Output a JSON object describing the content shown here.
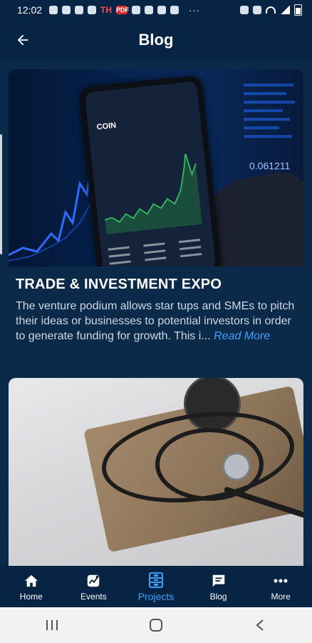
{
  "status_bar": {
    "time": "12:02",
    "th_label": "TH",
    "pdf_label": "PDF",
    "overflow": "···"
  },
  "header": {
    "title": "Blog"
  },
  "posts": [
    {
      "title": "TRADE & INVESTMENT EXPO",
      "excerpt": "The venture podium allows star tups and SMEs to pitch their ideas or businesses to potential investors in order to generate funding for growth. This i...",
      "read_more": "Read More",
      "image_alt": "phone showing stock chart",
      "image_text": "COIN"
    },
    {
      "title": "",
      "excerpt": "",
      "read_more": "",
      "image_alt": "stethoscope and blood pressure cuff"
    }
  ],
  "bottom_nav": {
    "items": [
      {
        "label": "Home",
        "icon": "home-icon"
      },
      {
        "label": "Events",
        "icon": "events-icon"
      },
      {
        "label": "Projects",
        "icon": "projects-icon",
        "active": true
      },
      {
        "label": "Blog",
        "icon": "blog-icon"
      },
      {
        "label": "More",
        "icon": "more-icon"
      }
    ]
  },
  "colors": {
    "background": "#0b2a4a",
    "bar": "#082444",
    "accent": "#3aa0ff"
  }
}
